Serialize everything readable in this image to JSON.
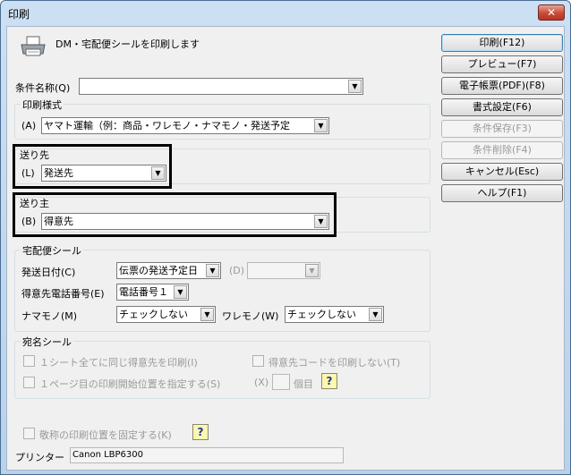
{
  "window": {
    "title": "印刷",
    "close_glyph": "✕"
  },
  "header": {
    "message": "DM・宅配便シールを印刷します",
    "icon": "printer-icon"
  },
  "condition": {
    "label": "条件名称(Q)",
    "value": ""
  },
  "print_style": {
    "group_label": "印刷様式",
    "field_label": "(A)",
    "value": "ヤマト運輸（例：商品・ワレモノ・ナマモノ・発送予定"
  },
  "destination": {
    "group_label": "送り先",
    "field_label": "(L)",
    "value": "発送先"
  },
  "sender": {
    "group_label": "送り主",
    "field_label": "(B)",
    "value": "得意先"
  },
  "delivery_seal": {
    "group_label": "宅配便シール",
    "ship_date_label": "発送日付(C)",
    "ship_date_value": "伝票の発送予定日",
    "d_label": "(D)",
    "d_value": "",
    "phone_label": "得意先電話番号(E)",
    "phone_value": "電話番号１",
    "namamono_label": "ナマモノ(M)",
    "namamono_value": "チェックしない",
    "waremono_label": "ワレモノ(W)",
    "waremono_value": "チェックしない"
  },
  "address_seal": {
    "group_label": "宛名シール",
    "opt1": "１シート全てに同じ得意先を印刷(I)",
    "opt2": "得意先コードを印刷しない(T)",
    "opt3": "１ページ目の印刷開始位置を指定する(S)",
    "x_label": "(X)",
    "x_value": "",
    "unit": "個目"
  },
  "honorific": {
    "label": "敬称の印刷位置を固定する(K)"
  },
  "printer": {
    "label": "プリンター",
    "value": "Canon LBP6300"
  },
  "buttons": {
    "print": "印刷(F12)",
    "preview": "プレビュー(F7)",
    "pdf": "電子帳票(PDF)(F8)",
    "format": "書式設定(F6)",
    "save": "条件保存(F3)",
    "delete": "条件削除(F4)",
    "cancel": "キャンセル(Esc)",
    "help": "ヘルプ(F1)"
  },
  "help_icon_glyph": "?"
}
